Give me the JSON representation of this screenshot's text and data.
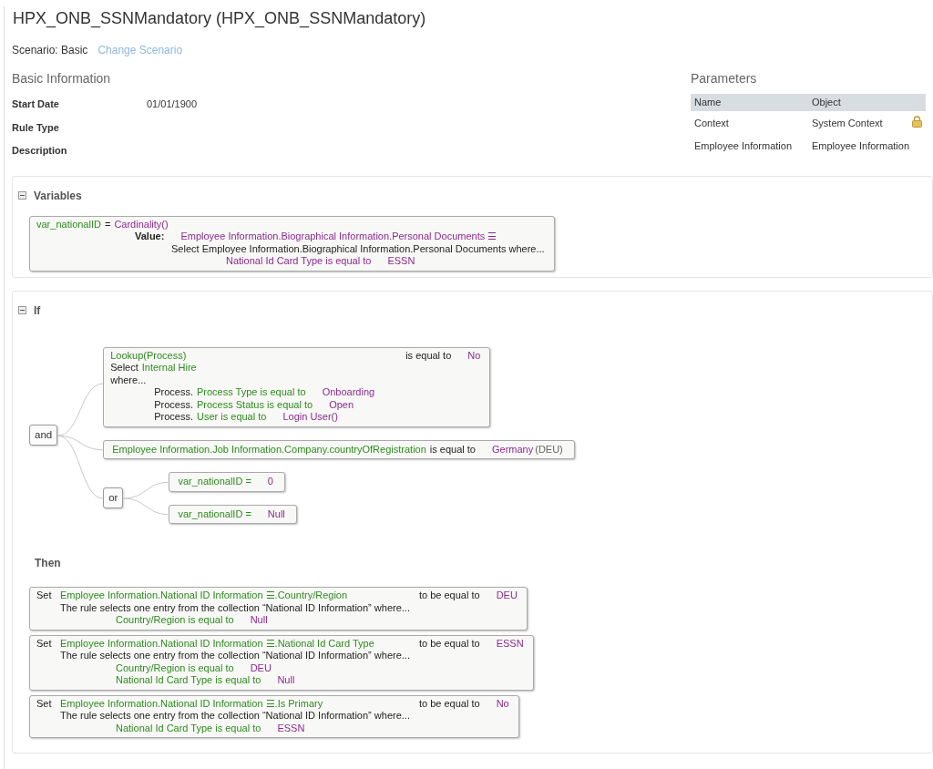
{
  "header": {
    "title": "HPX_ONB_SSNMandatory (HPX_ONB_SSNMandatory)",
    "scenario": "Scenario: Basic",
    "change_scenario_link": "Change Scenario"
  },
  "basic_information": {
    "heading": "Basic Information",
    "fields": [
      {
        "label": "Start Date",
        "value": "01/01/1900"
      },
      {
        "label": "Rule Type"
      },
      {
        "label": "Description"
      }
    ]
  },
  "parameters": {
    "heading": "Parameters",
    "columns": [
      "Name",
      "Object"
    ],
    "rows": [
      {
        "name": "Context",
        "object": "System Context",
        "locked": true
      },
      {
        "name": "Employee Information",
        "object": "Employee Information",
        "locked": false
      }
    ]
  },
  "variables": {
    "heading": "Variables",
    "expanded": true,
    "boxes": [
      {
        "kind": "variable",
        "lines": [
          {
            "kind": "head",
            "segments": [
              {
                "kind": "field",
                "text": "var_nationalID"
              },
              {
                "kind": "text",
                "text": "="
              },
              {
                "kind": "call",
                "text": "Cardinality()"
              }
            ]
          },
          {
            "kind": "value",
            "segments": [
              {
                "kind": "label",
                "text": "Value:"
              },
              {
                "kind": "value",
                "text": "Employee Information.Biographical Information.Personal Documents ☰"
              }
            ]
          },
          {
            "kind": "select",
            "segments": [
              {
                "kind": "text",
                "text": "Select Employee Information.Biographical Information.Personal Documents where..."
              }
            ]
          },
          {
            "kind": "condition",
            "segments": [
              {
                "kind": "call",
                "text": "National Id Card Type is equal to"
              },
              {
                "kind": "value",
                "text": "ESSN"
              }
            ]
          }
        ]
      }
    ]
  },
  "if_block": {
    "heading": "If",
    "expanded": true,
    "condition": {
      "kind": "operator",
      "label": "and",
      "children": [
        {
          "kind": "expression",
          "box": {
            "kind": "lookup",
            "lines": [
              {
                "kind": "head",
                "segments": [
                  {
                    "kind": "field",
                    "text": "Lookup(Process)"
                  }
                ]
              },
              {
                "kind": "head",
                "segments": [
                  {
                    "kind": "text",
                    "text": "Select"
                  },
                  {
                    "kind": "field",
                    "text": "Internal Hire"
                  }
                ]
              },
              {
                "kind": "head",
                "segments": [
                  {
                    "kind": "text",
                    "text": "where..."
                  }
                ]
              },
              {
                "kind": "condition",
                "segments": [
                  {
                    "kind": "text",
                    "text": "Process."
                  },
                  {
                    "kind": "field",
                    "text": "Process Type is equal to"
                  },
                  {
                    "kind": "value",
                    "text": "Onboarding"
                  }
                ]
              },
              {
                "kind": "condition",
                "segments": [
                  {
                    "kind": "text",
                    "text": "Process."
                  },
                  {
                    "kind": "field",
                    "text": "Process Status is equal to"
                  },
                  {
                    "kind": "value",
                    "text": "Open"
                  }
                ]
              },
              {
                "kind": "condition",
                "segments": [
                  {
                    "kind": "text",
                    "text": "Process."
                  },
                  {
                    "kind": "field",
                    "text": "User is equal to"
                  },
                  {
                    "kind": "value",
                    "text": "Login User()"
                  }
                ]
              }
            ],
            "result": [
              {
                "kind": "text",
                "text": "is equal to"
              },
              {
                "kind": "value",
                "text": "No"
              }
            ]
          }
        },
        {
          "kind": "expression",
          "box": {
            "kind": "comparison",
            "lines": [
              {
                "kind": "head",
                "segments": [
                  {
                    "kind": "field",
                    "text": "Employee Information.Job Information.Company.countryOfRegistration"
                  },
                  {
                    "kind": "text",
                    "text": "is equal to"
                  },
                  {
                    "kind": "value",
                    "text": "Germany"
                  },
                  {
                    "kind": "note",
                    "text": "(DEU)"
                  }
                ]
              }
            ]
          }
        },
        {
          "kind": "operator",
          "label": "or",
          "children": [
            {
              "kind": "expression",
              "box": {
                "kind": "comparison",
                "lines": [
                  {
                    "kind": "head",
                    "segments": [
                      {
                        "kind": "field",
                        "text": "var_nationalID ="
                      },
                      {
                        "kind": "value",
                        "text": "0"
                      }
                    ]
                  }
                ]
              }
            },
            {
              "kind": "expression",
              "box": {
                "kind": "comparison",
                "lines": [
                  {
                    "kind": "head",
                    "segments": [
                      {
                        "kind": "field",
                        "text": "var_nationalID ="
                      },
                      {
                        "kind": "value",
                        "text": "Null"
                      }
                    ]
                  }
                ]
              }
            }
          ]
        }
      ]
    }
  },
  "then_block": {
    "heading": "Then",
    "actions": [
      {
        "kind": "action",
        "prefix": "Set",
        "lines": [
          {
            "kind": "head",
            "segments": [
              {
                "kind": "field",
                "text": "Employee Information.National ID Information ☰.Country/Region"
              }
            ]
          },
          {
            "kind": "head",
            "segments": [
              {
                "kind": "text",
                "text": "The rule selects one entry from the collection “National ID Information” where..."
              }
            ]
          },
          {
            "kind": "condition",
            "segments": [
              {
                "kind": "field",
                "text": "Country/Region is equal to"
              },
              {
                "kind": "value",
                "text": "Null"
              }
            ]
          }
        ],
        "result": [
          {
            "kind": "text",
            "text": "to be equal to"
          },
          {
            "kind": "value",
            "text": "DEU"
          }
        ]
      },
      {
        "kind": "action",
        "prefix": "Set",
        "lines": [
          {
            "kind": "head",
            "segments": [
              {
                "kind": "field",
                "text": "Employee Information.National ID Information ☰.National Id Card Type"
              }
            ]
          },
          {
            "kind": "head",
            "segments": [
              {
                "kind": "text",
                "text": "The rule selects one entry from the collection “National ID Information” where..."
              }
            ]
          },
          {
            "kind": "condition",
            "segments": [
              {
                "kind": "field",
                "text": "Country/Region is equal to"
              },
              {
                "kind": "value",
                "text": "DEU"
              }
            ]
          },
          {
            "kind": "condition",
            "segments": [
              {
                "kind": "field",
                "text": "National Id Card Type is equal to"
              },
              {
                "kind": "value",
                "text": "Null"
              }
            ]
          }
        ],
        "result": [
          {
            "kind": "text",
            "text": "to be equal to"
          },
          {
            "kind": "value",
            "text": "ESSN"
          }
        ]
      },
      {
        "kind": "action",
        "prefix": "Set",
        "lines": [
          {
            "kind": "head",
            "segments": [
              {
                "kind": "field",
                "text": "Employee Information.National ID Information ☰.Is Primary"
              }
            ]
          },
          {
            "kind": "head",
            "segments": [
              {
                "kind": "text",
                "text": "The rule selects one entry from the collection “National ID Information” where..."
              }
            ]
          },
          {
            "kind": "condition",
            "segments": [
              {
                "kind": "field",
                "text": "National Id Card Type is equal to"
              },
              {
                "kind": "value",
                "text": "ESSN"
              }
            ]
          }
        ],
        "result": [
          {
            "kind": "text",
            "text": "to be equal to"
          },
          {
            "kind": "value",
            "text": "No"
          }
        ]
      }
    ]
  }
}
